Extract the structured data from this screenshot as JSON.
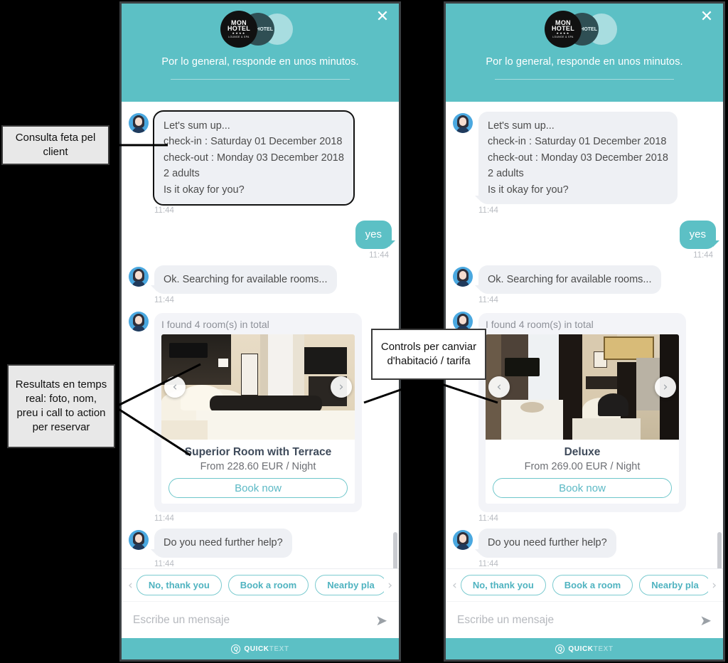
{
  "annotations": [
    {
      "id": "consulta",
      "text": "Consulta feta pel client"
    },
    {
      "id": "resultats",
      "text": "Resultats en temps real: foto, nom, preu i call to action per reservar"
    },
    {
      "id": "controls",
      "text": "Controls per canviar d'habitació / tarifa"
    }
  ],
  "colors": {
    "teal": "#5cc0c5",
    "bubble_bot": "#eef0f4",
    "bubble_user": "#5cc0c5",
    "accent_link": "#4fb3c0",
    "annotation_bg": "#e8e8e8"
  },
  "header": {
    "logo": {
      "line1": "MON",
      "line2": "HOTEL",
      "stars": "★★★★",
      "tagline": "LOUNGE & SPA",
      "badge": "MON HOTEL"
    },
    "subtitle": "Por lo general, responde en unos minutos.",
    "close_label": "✕"
  },
  "conversation": [
    {
      "from": "bot",
      "type": "text",
      "highlight": true,
      "lines": [
        "Let's sum up...",
        "check-in : Saturday 01 December 2018",
        "check-out : Monday 03 December 2018",
        "2 adults",
        "Is it okay for you?"
      ],
      "time": "11:44"
    },
    {
      "from": "user",
      "type": "text",
      "text": "yes",
      "time": "11:44"
    },
    {
      "from": "bot",
      "type": "text",
      "text": "Ok. Searching for available rooms...",
      "time": "11:44"
    },
    {
      "from": "bot",
      "type": "card",
      "time": "11:44"
    },
    {
      "from": "bot",
      "type": "text",
      "text": "Do you need further help?",
      "time": "11:44"
    }
  ],
  "card": {
    "header": "I found 4 room(s) in total",
    "prev_icon": "‹",
    "next_icon": "›",
    "book_label": "Book now",
    "left": {
      "title": "Superior Room with Terrace",
      "price": "From 228.60 EUR / Night"
    },
    "right": {
      "title": "Deluxe",
      "price": "From 269.00 EUR / Night"
    }
  },
  "quick_replies": {
    "prev_icon": "‹",
    "next_icon": "›",
    "items": [
      "No, thank you",
      "Book a room",
      "Nearby pla"
    ]
  },
  "composer": {
    "placeholder": "Escribe un mensaje",
    "send_icon": "➤"
  },
  "footer": {
    "mark": "Q",
    "brand_bold": "QUICK",
    "brand_light": "TEXT"
  }
}
